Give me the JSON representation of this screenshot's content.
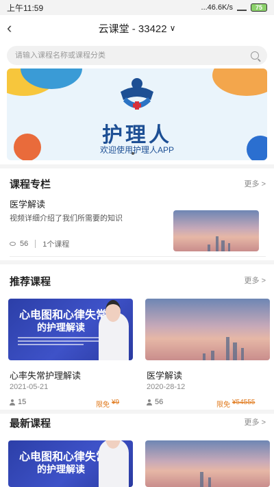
{
  "status_bar": {
    "time": "上午11:59",
    "speed": "...46.6K/s",
    "battery": "75"
  },
  "nav": {
    "back_icon": "chevron-left-icon",
    "title": "云课堂 - 33422",
    "dropdown_icon": "chevron-down-icon"
  },
  "search": {
    "placeholder": "请输入课程名称或课程分类"
  },
  "banner": {
    "title": "护理人",
    "subtitle": "欢迎使用护理人APP"
  },
  "column_section": {
    "title": "课程专栏",
    "more": "更多 >",
    "item": {
      "title": "医学解读",
      "description": "视频详细介绍了我们所需要的知识",
      "views": "56",
      "course_count": "1个课程"
    }
  },
  "recommended_section": {
    "title": "推荐课程",
    "more": "更多 >",
    "cards": [
      {
        "title": "心率失常护理解读",
        "date": "2021-05-21",
        "views": "15",
        "limited": "限免",
        "price": "¥9",
        "thumb_line1": "心电图和心律失常",
        "thumb_line2": "的护理解读"
      },
      {
        "title": "医学解读",
        "date": "2020-28-12",
        "views": "56",
        "limited": "限免",
        "price": "¥54555"
      }
    ]
  },
  "latest_section": {
    "title": "最新课程",
    "more": "更多 >",
    "cards": [
      {
        "thumb_line1": "心电图和心律失常",
        "thumb_line2": "的护理解读"
      },
      {}
    ]
  }
}
